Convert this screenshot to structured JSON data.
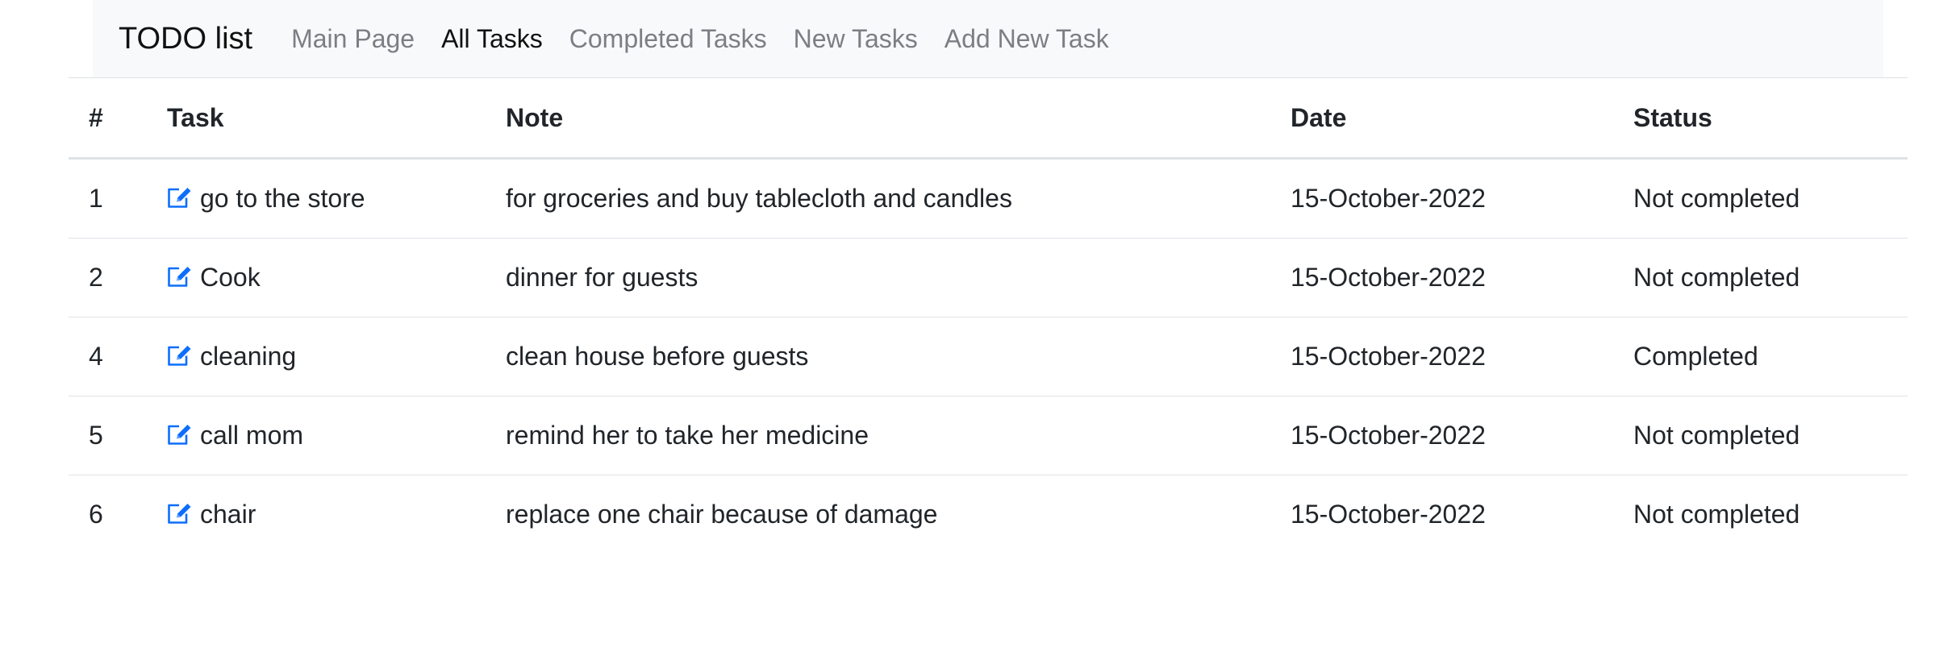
{
  "navbar": {
    "brand": "TODO list",
    "links": [
      {
        "label": "Main Page",
        "active": false
      },
      {
        "label": "All Tasks",
        "active": true
      },
      {
        "label": "Completed Tasks",
        "active": false
      },
      {
        "label": "New Tasks",
        "active": false
      },
      {
        "label": "Add New Task",
        "active": false
      }
    ]
  },
  "table": {
    "headers": [
      "#",
      "Task",
      "Note",
      "Date",
      "Status"
    ],
    "rows": [
      {
        "id": "1",
        "task": "go to the store",
        "note": "for groceries and buy tablecloth and candles",
        "date": "15-October-2022",
        "status": "Not completed"
      },
      {
        "id": "2",
        "task": "Cook",
        "note": "dinner for guests",
        "date": "15-October-2022",
        "status": "Not completed"
      },
      {
        "id": "4",
        "task": "cleaning",
        "note": "clean house before guests",
        "date": "15-October-2022",
        "status": "Completed"
      },
      {
        "id": "5",
        "task": "call mom",
        "note": "remind her to take her medicine",
        "date": "15-October-2022",
        "status": "Not completed"
      },
      {
        "id": "6",
        "task": "chair",
        "note": "replace one chair because of damage",
        "date": "15-October-2022",
        "status": "Not completed"
      }
    ]
  },
  "icons": {
    "edit": "edit-icon"
  },
  "colors": {
    "accent": "#0d6efd",
    "nav_bg": "#f8f9fa",
    "nav_muted": "#7b7f84",
    "border": "#dee2e6"
  }
}
